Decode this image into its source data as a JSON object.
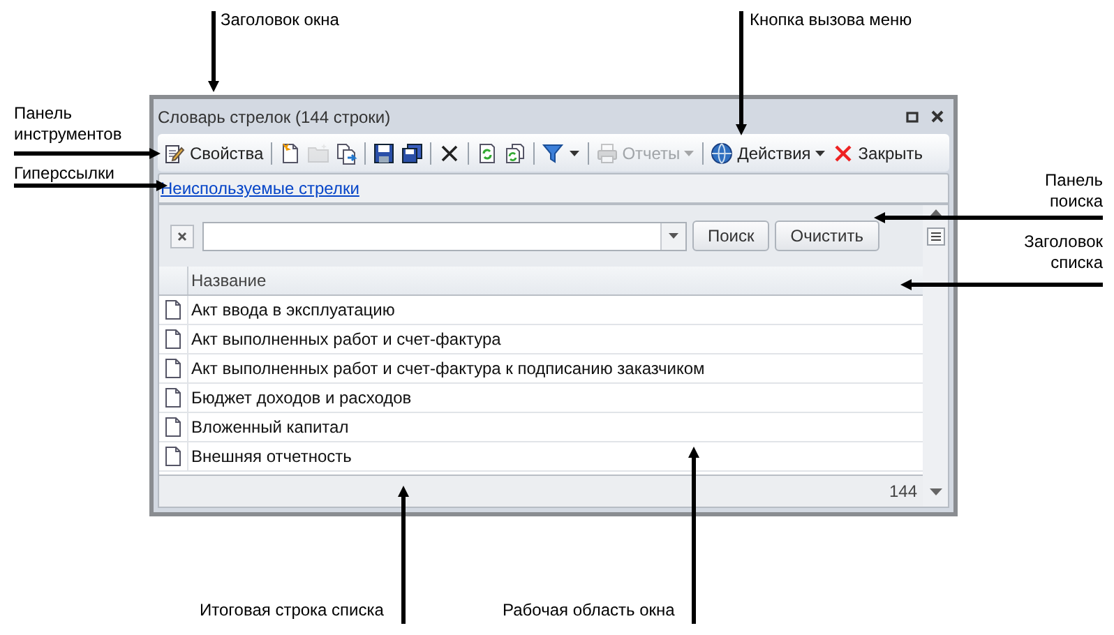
{
  "annotations": [
    {
      "text": "Заголовок окна"
    },
    {
      "text": "Кнопка вызова меню"
    },
    {
      "text": "Панель инструментов"
    },
    {
      "text": "Гиперссылки"
    },
    {
      "text": "Панель поиска"
    },
    {
      "text": "Заголовок списка"
    },
    {
      "text": "Итоговая строка списка"
    },
    {
      "text": "Рабочая область окна"
    }
  ],
  "window": {
    "title": "Словарь стрелок (144 строки)",
    "toolbar": [
      {
        "kind": "button",
        "label": "Свойства",
        "disabled": false,
        "dropdown": false
      },
      {
        "kind": "separator"
      },
      {
        "kind": "icon",
        "disabled": false,
        "dropdown": false
      },
      {
        "kind": "icon",
        "disabled": true,
        "dropdown": false
      },
      {
        "kind": "icon",
        "disabled": false,
        "dropdown": false
      },
      {
        "kind": "separator"
      },
      {
        "kind": "icon",
        "disabled": false,
        "dropdown": false
      },
      {
        "kind": "icon",
        "disabled": false,
        "dropdown": false
      },
      {
        "kind": "separator"
      },
      {
        "kind": "icon",
        "disabled": false,
        "dropdown": false
      },
      {
        "kind": "separator"
      },
      {
        "kind": "icon",
        "disabled": false,
        "dropdown": false
      },
      {
        "kind": "icon",
        "disabled": false,
        "dropdown": false
      },
      {
        "kind": "separator"
      },
      {
        "kind": "icon",
        "disabled": false,
        "dropdown": true
      },
      {
        "kind": "separator"
      },
      {
        "kind": "button",
        "label": "Отчеты",
        "disabled": true,
        "dropdown": true
      },
      {
        "kind": "separator"
      },
      {
        "kind": "button",
        "label": "Действия",
        "disabled": false,
        "dropdown": true
      },
      {
        "kind": "button",
        "label": "Закрыть",
        "disabled": false,
        "dropdown": false
      }
    ],
    "link": "Неиспользуемые стрелки",
    "search": {
      "buttons": [
        "Поиск",
        "Очистить"
      ]
    },
    "table": {
      "columns": [
        "Название"
      ],
      "rows": [
        "Акт ввода в эксплуатацию",
        "Акт выполненных работ и счет-фактура",
        "Акт выполненных работ и счет-фактура к подписанию заказчиком",
        "Бюджет доходов и расходов",
        "Вложенный капитал",
        "Внешняя отчетность"
      ]
    },
    "footer": {
      "count": "144"
    }
  }
}
